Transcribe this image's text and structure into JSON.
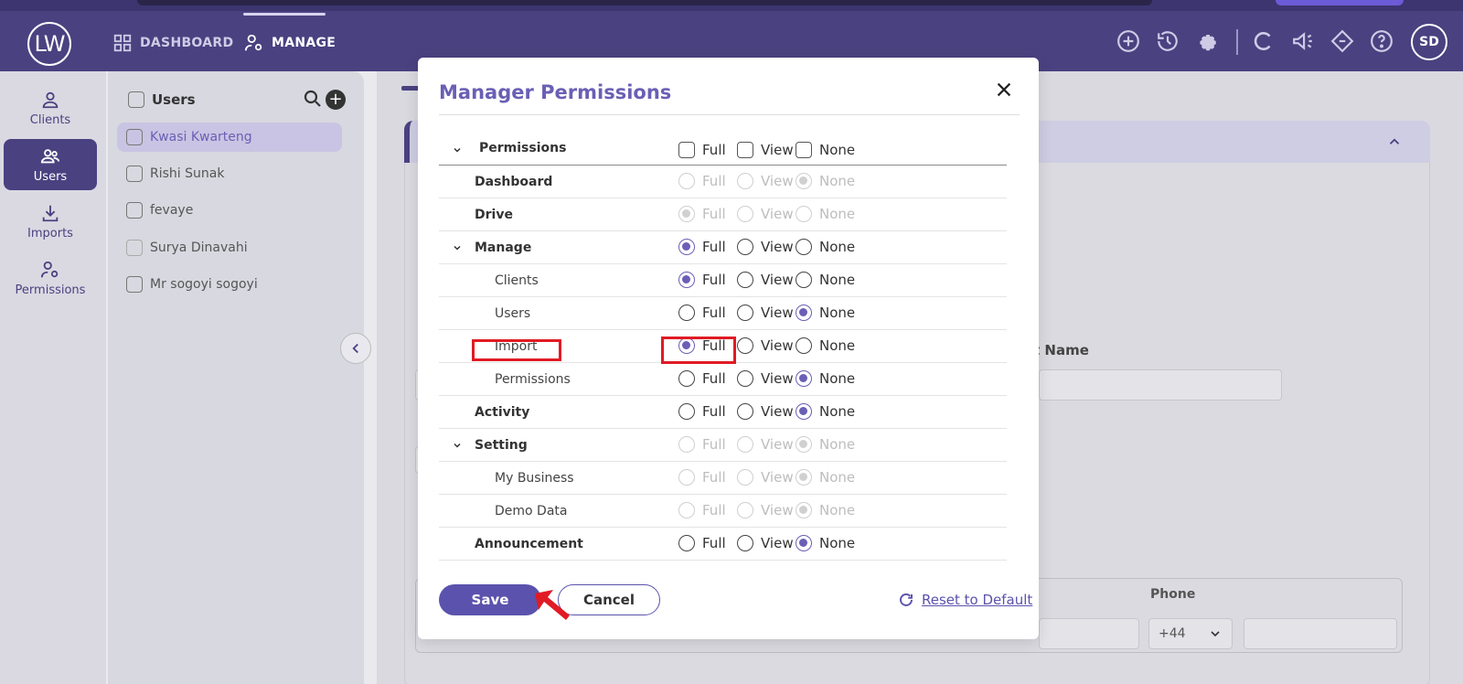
{
  "app": {
    "logo_text": "LW",
    "nav": [
      {
        "label": "DASHBOARD",
        "icon": "grid-icon"
      },
      {
        "label": "MANAGE",
        "icon": "user-gear-icon"
      }
    ],
    "top_icons": [
      "add-circle-icon",
      "history-icon",
      "settings-icon",
      "c-logo-icon",
      "megaphone-icon",
      "diamond-icon",
      "help-icon"
    ],
    "avatar_initials": "SD"
  },
  "sidebar": {
    "items": [
      {
        "label": "Clients",
        "icon": "person-icon"
      },
      {
        "label": "Users",
        "icon": "users-icon"
      },
      {
        "label": "Imports",
        "icon": "download-icon"
      },
      {
        "label": "Permissions",
        "icon": "person-gear-icon"
      }
    ]
  },
  "users_panel": {
    "title": "Users",
    "rows": [
      "Kwasi Kwarteng",
      "Rishi Sunak",
      "fevaye",
      "Surya Dinavahi",
      "Mr sogoyi sogoyi"
    ]
  },
  "background": {
    "last_name_label": "t Name",
    "phone_label": "Phone",
    "country_code": "+44"
  },
  "modal": {
    "title": "Manager Permissions",
    "header": {
      "label": "Permissions",
      "options": [
        "Full",
        "View",
        "None"
      ]
    },
    "rows": [
      {
        "label": "Dashboard",
        "selected": "None",
        "disabled": true
      },
      {
        "label": "Drive",
        "selected": "Full",
        "disabled": true
      },
      {
        "label": "Manage",
        "selected": "Full",
        "disabled": false
      },
      {
        "label": "Clients",
        "selected": "Full",
        "disabled": false
      },
      {
        "label": "Users",
        "selected": "None",
        "disabled": false
      },
      {
        "label": "Import",
        "selected": "Full",
        "disabled": false
      },
      {
        "label": "Permissions",
        "selected": "None",
        "disabled": false
      },
      {
        "label": "Activity",
        "selected": "None",
        "disabled": false
      },
      {
        "label": "Setting",
        "selected": "None",
        "disabled": true
      },
      {
        "label": "My Business",
        "selected": "None",
        "disabled": true
      },
      {
        "label": "Demo Data",
        "selected": "None",
        "disabled": true
      },
      {
        "label": "Announcement",
        "selected": "None",
        "disabled": false
      }
    ],
    "save_label": "Save",
    "cancel_label": "Cancel",
    "reset_label": "Reset to Default"
  },
  "colors": {
    "brand": "#4a4180",
    "accent": "#6a5fb5",
    "highlight": "#e01b24"
  }
}
